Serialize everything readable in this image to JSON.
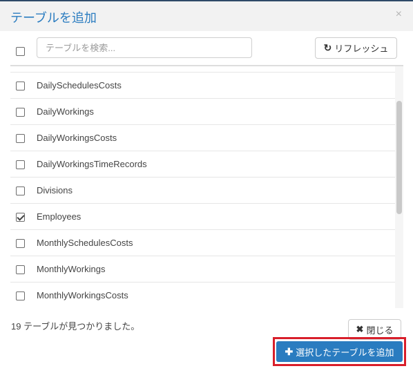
{
  "modal": {
    "title": "テーブルを追加",
    "close_glyph": "×"
  },
  "toolbar": {
    "search_placeholder": "テーブルを検索...",
    "search_value": "",
    "refresh_icon": "↻",
    "refresh_label": "リフレッシュ"
  },
  "tables": [
    {
      "name": "DailySchedulesCosts",
      "checked": false
    },
    {
      "name": "DailyWorkings",
      "checked": false
    },
    {
      "name": "DailyWorkingsCosts",
      "checked": false
    },
    {
      "name": "DailyWorkingsTimeRecords",
      "checked": false
    },
    {
      "name": "Divisions",
      "checked": false
    },
    {
      "name": "Employees",
      "checked": true
    },
    {
      "name": "MonthlySchedulesCosts",
      "checked": false
    },
    {
      "name": "MonthlyWorkings",
      "checked": false
    },
    {
      "name": "MonthlyWorkingsCosts",
      "checked": false
    }
  ],
  "footer": {
    "count_text": "19 テーブルが見つかりました。",
    "close_icon": "✖",
    "close_label": "閉じる",
    "add_icon": "✚",
    "add_label": "選択したテーブルを追加"
  },
  "colors": {
    "accent": "#2a7cc0",
    "highlight_border": "#d81e2a",
    "header_bg": "#f2f2f2"
  },
  "icons": [
    "refresh-icon",
    "close-icon",
    "plus-icon"
  ]
}
